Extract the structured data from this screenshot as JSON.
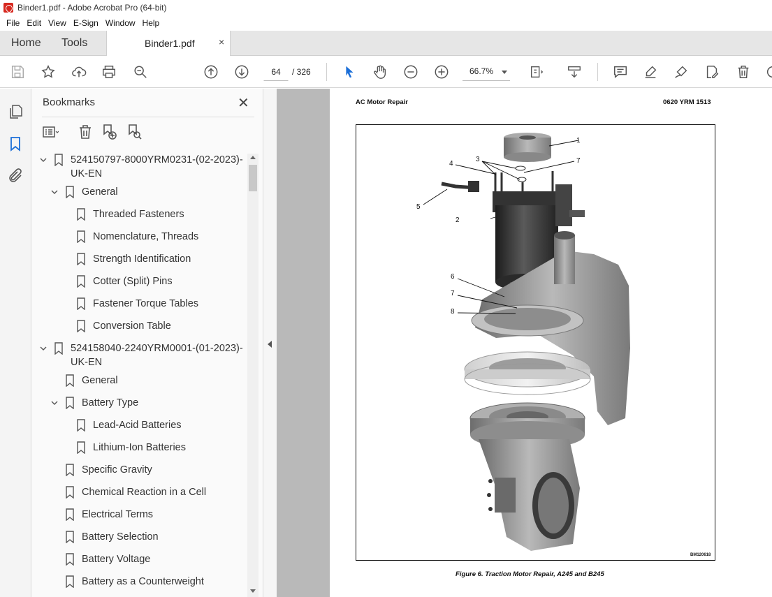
{
  "window": {
    "title": "Binder1.pdf - Adobe Acrobat Pro (64-bit)"
  },
  "menu": [
    "File",
    "Edit",
    "View",
    "E-Sign",
    "Window",
    "Help"
  ],
  "tabs": {
    "home": "Home",
    "tools": "Tools",
    "document": "Binder1.pdf",
    "close_glyph": "×"
  },
  "toolbar": {
    "page_current": "64",
    "page_total": "/ 326",
    "zoom": "66.7%"
  },
  "bookmarks": {
    "title": "Bookmarks",
    "close_glyph": "✕",
    "items": [
      {
        "label": "524150797-8000YRM0231-(02-2023)-",
        "label2": "UK-EN",
        "level": 0,
        "expanded": true
      },
      {
        "label": "General",
        "level": 1,
        "expanded": true
      },
      {
        "label": "Threaded Fasteners",
        "level": 2
      },
      {
        "label": "Nomenclature, Threads",
        "level": 2
      },
      {
        "label": "Strength Identification",
        "level": 2
      },
      {
        "label": "Cotter (Split) Pins",
        "level": 2
      },
      {
        "label": "Fastener Torque Tables",
        "level": 2
      },
      {
        "label": "Conversion Table",
        "level": 2
      },
      {
        "label": "524158040-2240YRM0001-(01-2023)-",
        "label2": "UK-EN",
        "level": 0,
        "expanded": true
      },
      {
        "label": "General",
        "level": 1
      },
      {
        "label": "Battery Type",
        "level": 1,
        "expanded": true
      },
      {
        "label": "Lead-Acid Batteries",
        "level": 2
      },
      {
        "label": "Lithium-Ion Batteries",
        "level": 2
      },
      {
        "label": "Specific Gravity",
        "level": 1
      },
      {
        "label": "Chemical Reaction in a Cell",
        "level": 1
      },
      {
        "label": "Electrical Terms",
        "level": 1
      },
      {
        "label": "Battery Selection",
        "level": 1
      },
      {
        "label": "Battery Voltage",
        "level": 1
      },
      {
        "label": "Battery as a Counterweight",
        "level": 1
      }
    ]
  },
  "document": {
    "header_left": "AC Motor Repair",
    "header_right": "0620 YRM 1513",
    "figure_id": "BM120618",
    "caption": "Figure 6. Traction Motor Repair, A245 and B245",
    "callouts": [
      "1",
      "2",
      "3",
      "4",
      "5",
      "6",
      "7",
      "7",
      "8"
    ]
  }
}
